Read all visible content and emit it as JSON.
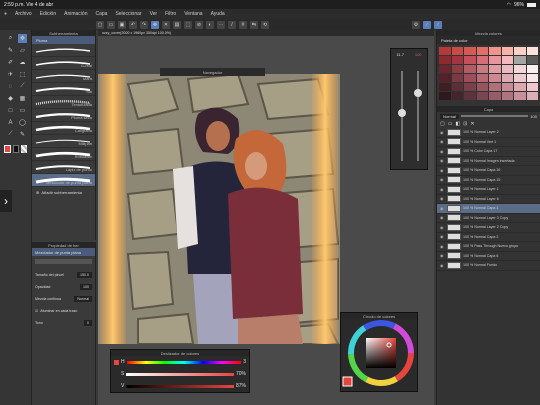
{
  "status": {
    "time": "2:59 p.m.",
    "date": "Vie 4 de abr",
    "battery": "96%"
  },
  "menu": [
    "Archivo",
    "Edición",
    "Animación",
    "Capa",
    "Seleccionar",
    "Ver",
    "Filtro",
    "Ventana",
    "Ayuda"
  ],
  "canvas": {
    "tab_title": "ozzy_cover(2000 x 1960px 350dpi 100.0%)",
    "navigator_label": "Navegador",
    "zoom_top": "11.7",
    "zoom_pct": "100"
  },
  "subtool": {
    "title": "Subherramienta",
    "header": "Pluma",
    "brushes": [
      "",
      "G-real",
      "Mara",
      "Sai",
      "Texturizada",
      "Pluma seca",
      "Caligrafía",
      "Millipan",
      "Rotulador",
      "Lápiz de punto",
      "Mezclador de punta plana"
    ],
    "add_label": "Añadir subherramienta"
  },
  "props": {
    "title": "Propiedad de her",
    "tool_name": "Mezclador de punta plana",
    "rows": [
      {
        "label": "Tamaño del pincel",
        "value": "150.0"
      },
      {
        "label": "Opacidad",
        "value": "100"
      },
      {
        "label": "Mezcla continua",
        "value": "Normal"
      },
      {
        "label": "Afuminar en cada trazo",
        "value": ""
      },
      {
        "label": "Tono",
        "value": "0"
      }
    ]
  },
  "color_sliders": {
    "title": "Deslizador de colores",
    "rows": [
      {
        "label": "H",
        "value": "3"
      },
      {
        "label": "S",
        "value": "70%"
      },
      {
        "label": "V",
        "value": "87%"
      }
    ]
  },
  "color_wheel": {
    "title": "Círculo de colores",
    "accent": "#e5453e"
  },
  "palette": {
    "title": "Mezcla colores",
    "sub": "Paleta de color",
    "colors": [
      "#b73a3a",
      "#c94b45",
      "#d25c55",
      "#e16f66",
      "#f0938a",
      "#f8b2a8",
      "#fcd0c7",
      "#fbe3dc",
      "#8c2a2f",
      "#a33540",
      "#c3505c",
      "#d46f78",
      "#e8959b",
      "#f5b9bd",
      "#a6a5a5",
      "#5a5a5a",
      "#6d2530",
      "#8f3b44",
      "#b45b64",
      "#cc7a82",
      "#e19ca2",
      "#ecbac0",
      "#f4d5d8",
      "#faeeee",
      "#55202a",
      "#7a3a44",
      "#9c4f5b",
      "#b56a75",
      "#cc8893",
      "#dcaab2",
      "#ebcbd0",
      "#f7e7ea",
      "#3f1f24",
      "#5c2e35",
      "#7a3f48",
      "#955660",
      "#b07079",
      "#c88c95",
      "#dda8af",
      "#eec6cc",
      "#2d1a1f",
      "#43252c",
      "#5c343d",
      "#784751",
      "#955d68",
      "#ae7580",
      "#c7919b",
      "#dcaeb6"
    ]
  },
  "layers": {
    "title": "Capa",
    "blend": "Normal",
    "opacity": "100",
    "items": [
      {
        "name": "100 % Normal Layer 2",
        "sel": false
      },
      {
        "name": "100 % Normal Vert 1",
        "sel": false
      },
      {
        "name": "100 % Color Capa 17",
        "sel": false
      },
      {
        "name": "100 % Normal Imagen insertada",
        "sel": false
      },
      {
        "name": "100 % Normal Capa 16",
        "sel": false
      },
      {
        "name": "100 % Normal Capa 15",
        "sel": false
      },
      {
        "name": "100 % Normal Layer 1",
        "sel": false
      },
      {
        "name": "100 % Normal Layer 6",
        "sel": false
      },
      {
        "name": "100 % Normal Capa 1",
        "sel": true
      },
      {
        "name": "100 % Normal Layer 3 Copy",
        "sel": false
      },
      {
        "name": "100 % Normal Layer 2 Copy",
        "sel": false
      },
      {
        "name": "100 % Normal Capa 2",
        "sel": false
      },
      {
        "name": "100 % Pass Through Nuevo grupo",
        "sel": false
      },
      {
        "name": "100 % Normal Capa 6",
        "sel": false
      },
      {
        "name": "100 % Normal Fondo",
        "sel": false
      }
    ]
  }
}
